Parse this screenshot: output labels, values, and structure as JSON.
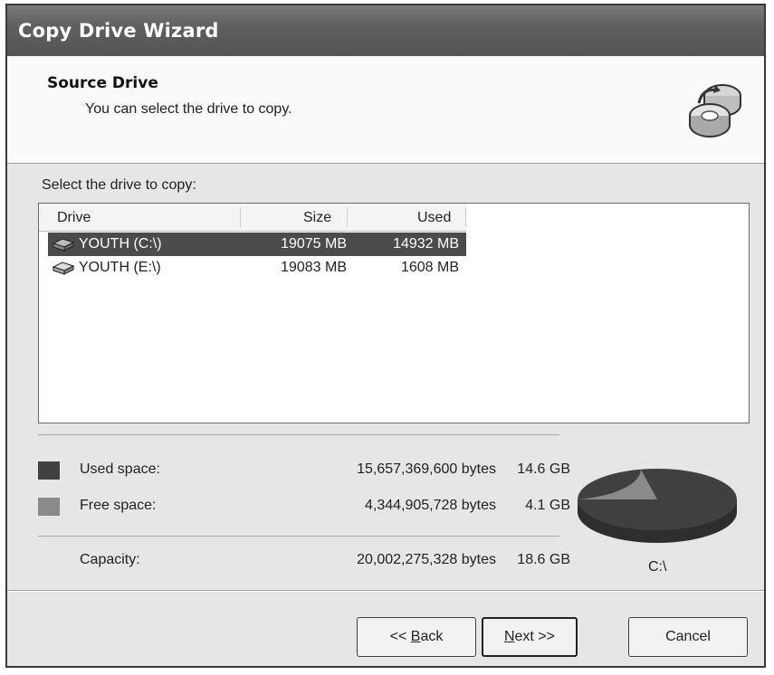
{
  "window": {
    "title": "Copy Drive Wizard"
  },
  "header": {
    "title": "Source Drive",
    "subtitle": "You can select the drive to copy.",
    "icon": "drive-copy-icon"
  },
  "drive_select": {
    "label": "Select the drive to copy:",
    "columns": [
      "Drive",
      "Size",
      "Used"
    ],
    "rows": [
      {
        "drive": "YOUTH (C:\\)",
        "size": "19075 MB",
        "used": "14932 MB",
        "selected": true
      },
      {
        "drive": "YOUTH (E:\\)",
        "size": "19083 MB",
        "used": "1608 MB",
        "selected": false
      }
    ]
  },
  "space": {
    "used": {
      "label": "Used space:",
      "bytes": "15,657,369,600 bytes",
      "gb": "14.6 GB",
      "color": "#404040"
    },
    "free": {
      "label": "Free space:",
      "bytes": "4,344,905,728 bytes",
      "gb": "4.1 GB",
      "color": "#8a8a8a"
    },
    "capacity": {
      "label": "Capacity:",
      "bytes": "20,002,275,328 bytes",
      "gb": "18.6 GB"
    },
    "pie_drive": "C:\\",
    "used_fraction": 0.783
  },
  "buttons": {
    "back": {
      "prefix": "<< ",
      "underline": "B",
      "rest": "ack"
    },
    "next": {
      "underline": "N",
      "rest": "ext >>"
    },
    "cancel": "Cancel"
  }
}
